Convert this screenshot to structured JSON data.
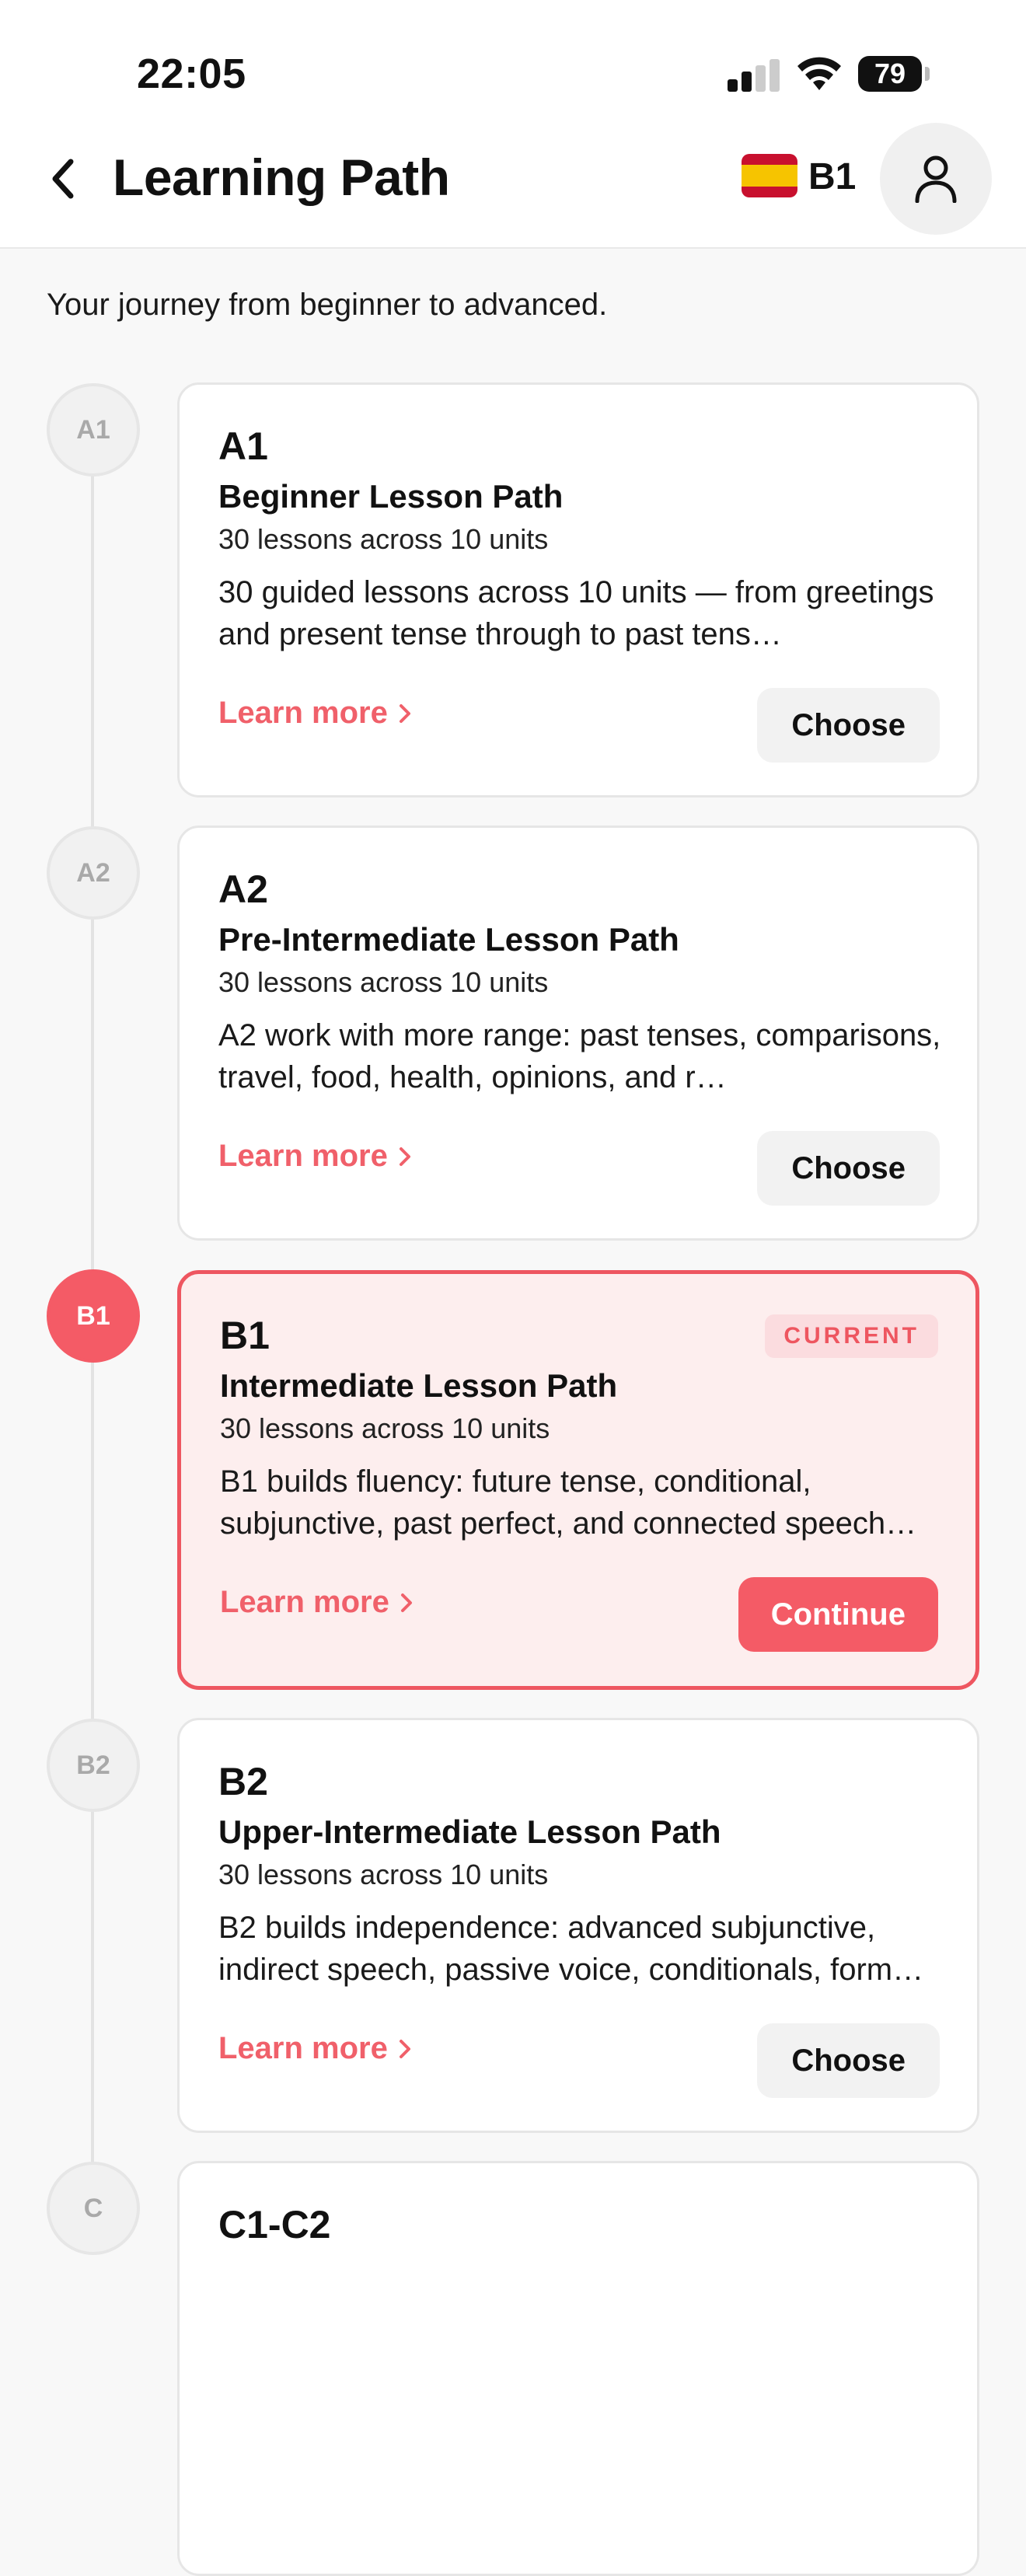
{
  "status_bar": {
    "time": "22:05",
    "battery": "79"
  },
  "header": {
    "title": "Learning Path",
    "language_level": "B1",
    "flag_icon": "spain-flag-icon",
    "colors": {
      "accent": "#f45b66"
    }
  },
  "subtitle": "Your journey from beginner to advanced.",
  "levels": [
    {
      "node": "A1",
      "level": "A1",
      "title": "Beginner Lesson Path",
      "meta": "30 lessons across 10 units",
      "description": "30 guided lessons across 10 units — from greetings and present tense through to past tens…",
      "learn_more": "Learn more",
      "action": "Choose",
      "current": false
    },
    {
      "node": "A2",
      "level": "A2",
      "title": "Pre-Intermediate Lesson Path",
      "meta": "30 lessons across 10 units",
      "description": "A2 work with more range: past tenses, comparisons, travel, food, health, opinions, and r…",
      "learn_more": "Learn more",
      "action": "Choose",
      "current": false
    },
    {
      "node": "B1",
      "level": "B1",
      "badge": "CURRENT",
      "title": "Intermediate Lesson Path",
      "meta": "30 lessons across 10 units",
      "description": "B1 builds fluency: future tense, conditional, subjunctive, past perfect, and connected speech…",
      "learn_more": "Learn more",
      "action": "Continue",
      "current": true
    },
    {
      "node": "B2",
      "level": "B2",
      "title": "Upper-Intermediate Lesson Path",
      "meta": "30 lessons across 10 units",
      "description": "B2 builds independence: advanced subjunctive, indirect speech, passive voice, conditionals, form…",
      "learn_more": "Learn more",
      "action": "Choose",
      "current": false
    },
    {
      "node": "C",
      "level": "C1-C2"
    }
  ]
}
